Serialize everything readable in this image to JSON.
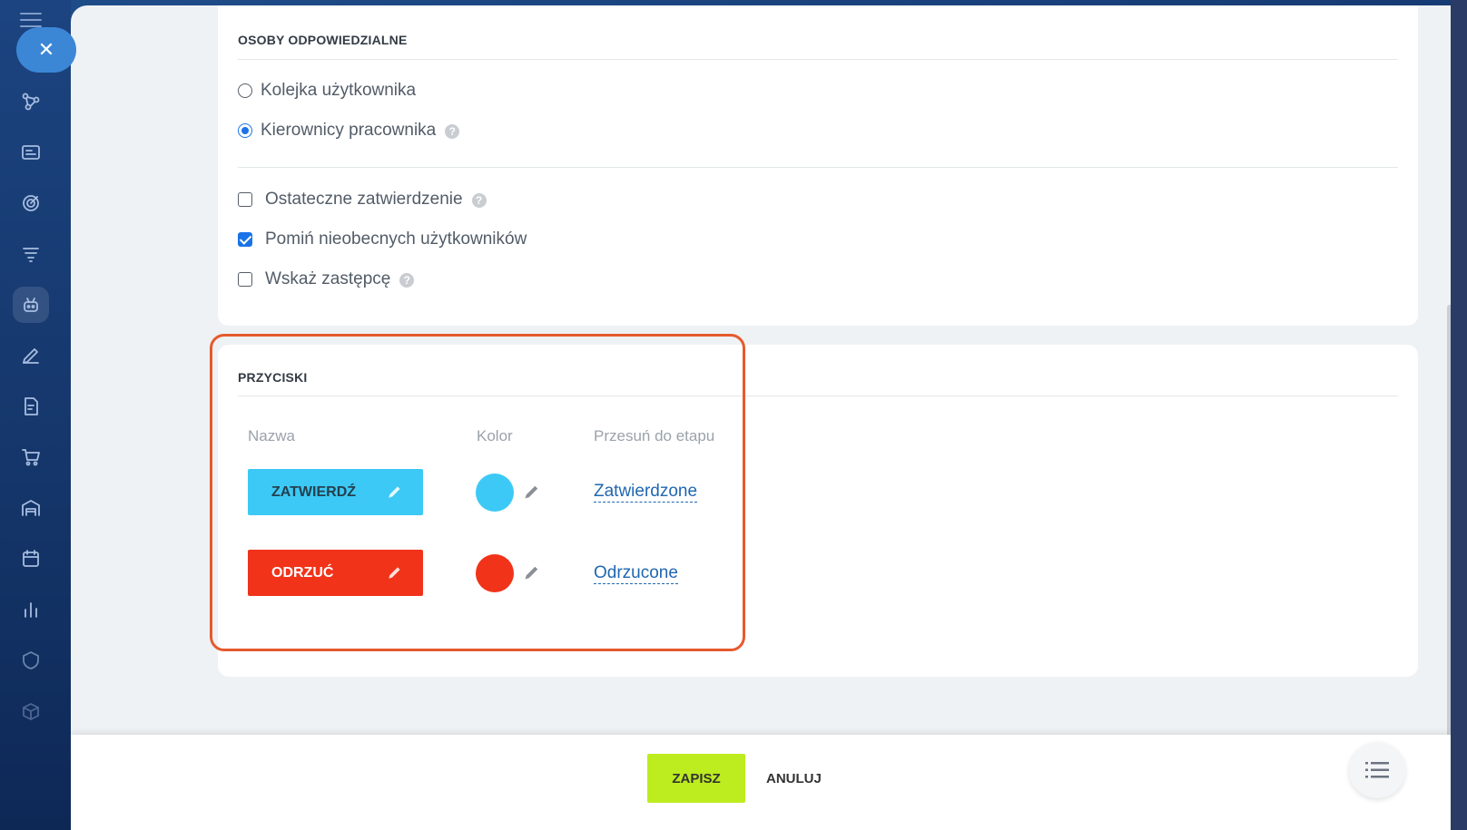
{
  "sidebar": {
    "icons": [
      "flow-icon",
      "card-icon",
      "target-icon",
      "funnel-icon",
      "robot-icon",
      "edit-icon",
      "document-icon",
      "cart-icon",
      "warehouse-icon",
      "calendar-icon",
      "chart-icon",
      "shield-icon",
      "box-icon"
    ]
  },
  "responsible": {
    "title": "OSOBY ODPOWIEDZIALNE",
    "radio_queue": "Kolejka użytkownika",
    "radio_managers": "Kierownicy pracownika",
    "radio_selected": "managers",
    "check_final": "Ostateczne zatwierdzenie",
    "check_final_checked": false,
    "check_skip_absent": "Pomiń nieobecnych użytkowników",
    "check_skip_absent_checked": true,
    "check_deputy": "Wskaż zastępcę",
    "check_deputy_checked": false
  },
  "buttons_section": {
    "title": "PRZYCISKI",
    "col_name": "Nazwa",
    "col_color": "Kolor",
    "col_stage": "Przesuń do etapu",
    "rows": [
      {
        "label": "ZATWIERDŹ",
        "color": "#3cc9f5",
        "stage": "Zatwierdzone"
      },
      {
        "label": "ODRZUĆ",
        "color": "#f1331a",
        "stage": "Odrzucone"
      }
    ]
  },
  "footer": {
    "save_label": "ZAPISZ",
    "cancel_label": "ANULUJ"
  },
  "colors": {
    "save_button": "#bdec1f",
    "link": "#2067b0",
    "highlight": "#e65a2e"
  }
}
